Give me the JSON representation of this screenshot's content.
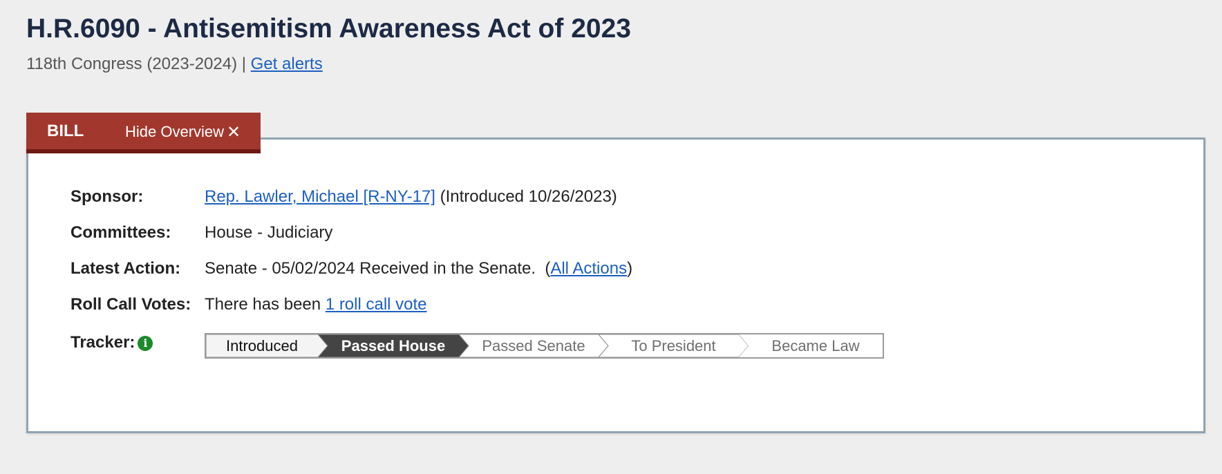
{
  "header": {
    "title": "H.R.6090 - Antisemitism Awareness Act of 2023",
    "congress": "118th Congress (2023-2024) | ",
    "alerts_link": "Get alerts"
  },
  "tabs": {
    "bill_label": "BILL",
    "hide_label": "Hide Overview",
    "hide_icon": "close-icon"
  },
  "overview": {
    "sponsor": {
      "label": "Sponsor:",
      "link": "Rep. Lawler, Michael [R-NY-17]",
      "suffix": " (Introduced 10/26/2023)"
    },
    "committees": {
      "label": "Committees:",
      "value": "House - Judiciary"
    },
    "latest_action": {
      "label": "Latest Action:",
      "value": "Senate - 05/02/2024 Received in the Senate.  (",
      "link": "All Actions",
      "close": ")"
    },
    "roll_call": {
      "label": "Roll Call Votes:",
      "prefix": "There has been ",
      "link": "1 roll call vote"
    },
    "tracker": {
      "label": "Tracker:",
      "info_icon": "info-icon",
      "steps": [
        {
          "label": "Introduced",
          "state": "completed"
        },
        {
          "label": "Passed House",
          "state": "current"
        },
        {
          "label": "Passed Senate",
          "state": "pending"
        },
        {
          "label": "To President",
          "state": "pending"
        },
        {
          "label": "Became Law",
          "state": "pending"
        }
      ]
    }
  },
  "colors": {
    "tab_bg": "#a2382d",
    "tab_border": "#6e1812",
    "link": "#1b5fc2",
    "title": "#1d2a45",
    "tracker_current": "#444444",
    "tracker_completed": "#f4f4f4",
    "info_icon": "#1a8a2a"
  }
}
